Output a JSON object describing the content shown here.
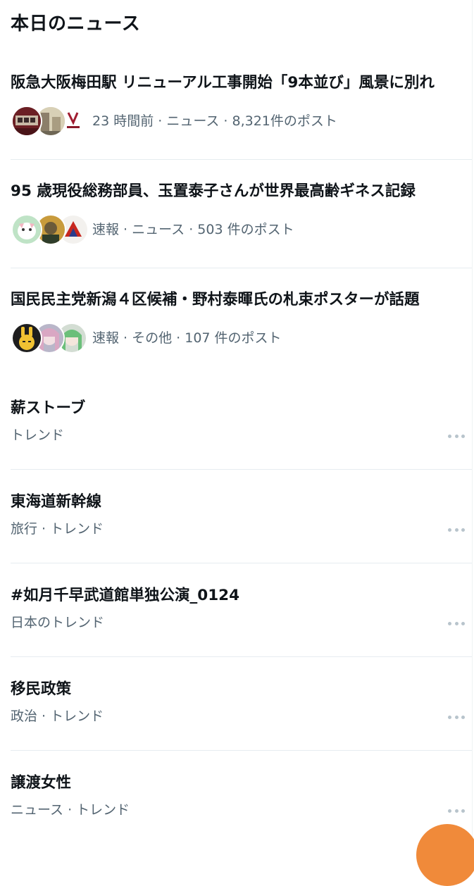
{
  "section": {
    "title": "本日のニュース"
  },
  "news": [
    {
      "title": "阪急大阪梅田駅 リニューアル工事開始「9本並び」風景に別れ",
      "meta": "23 時間前 · ニュース · 8,321件のポスト",
      "avatars": [
        "train-thumbnail",
        "street-thumbnail",
        "hankyu-logo-thumbnail"
      ]
    },
    {
      "title": "95 歳現役総務部員、玉置泰子さんが世界最高齢ギネス記録",
      "meta": "速報 · ニュース · 503 件のポスト",
      "avatars": [
        "cat-illustration",
        "portrait-illustration",
        "dragon-illustration"
      ]
    },
    {
      "title": "国民民主党新潟４区候補・野村泰暉氏の札束ポスターが話題",
      "meta": "速報 · その他 · 107 件のポスト",
      "avatars": [
        "rabbit-illustration",
        "anime-character-pink",
        "anime-character-green"
      ]
    }
  ],
  "trends": [
    {
      "title": "薪ストーブ",
      "meta": "トレンド"
    },
    {
      "title": "東海道新幹線",
      "meta": "旅行 · トレンド"
    },
    {
      "title": "#如月千早武道館単独公演_0124",
      "meta": "日本のトレンド"
    },
    {
      "title": "移民政策",
      "meta": "政治 · トレンド"
    },
    {
      "title": "譲渡女性",
      "meta": "ニュース · トレンド"
    }
  ],
  "icons": {
    "more": "more-horizontal-icon",
    "fab": "compose-button"
  },
  "colors": {
    "accent": "#f08a3a",
    "secondary_text": "#536471",
    "divider": "#e6ecf0"
  }
}
